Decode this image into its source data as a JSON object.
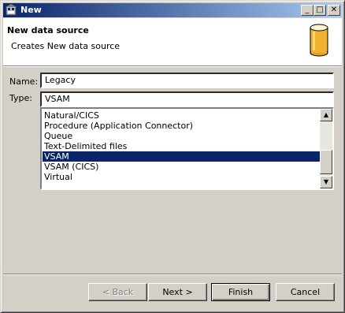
{
  "window": {
    "title": "New",
    "controls": {
      "minimize": "_",
      "maximize": "□",
      "close": "✕"
    }
  },
  "header": {
    "title": "New data source",
    "description": "Creates New data source",
    "icon": "database-cylinder-icon",
    "icon_color": "#f0b030"
  },
  "form": {
    "name_label": "Name:",
    "name_value": "Legacy",
    "type_label": "Type:",
    "type_value": "VSAM"
  },
  "type_list": {
    "items": [
      "Natural/CICS",
      "Procedure (Application Connector)",
      "Queue",
      "Text-Delimited files",
      "VSAM",
      "VSAM (CICS)",
      "Virtual"
    ],
    "selected": "VSAM"
  },
  "buttons": {
    "back": "< Back",
    "next": "Next >",
    "finish": "Finish",
    "cancel": "Cancel"
  },
  "colors": {
    "titlebar_start": "#0a246a",
    "titlebar_end": "#a6caf0",
    "selection": "#0a246a",
    "face": "#d4d0c8"
  }
}
